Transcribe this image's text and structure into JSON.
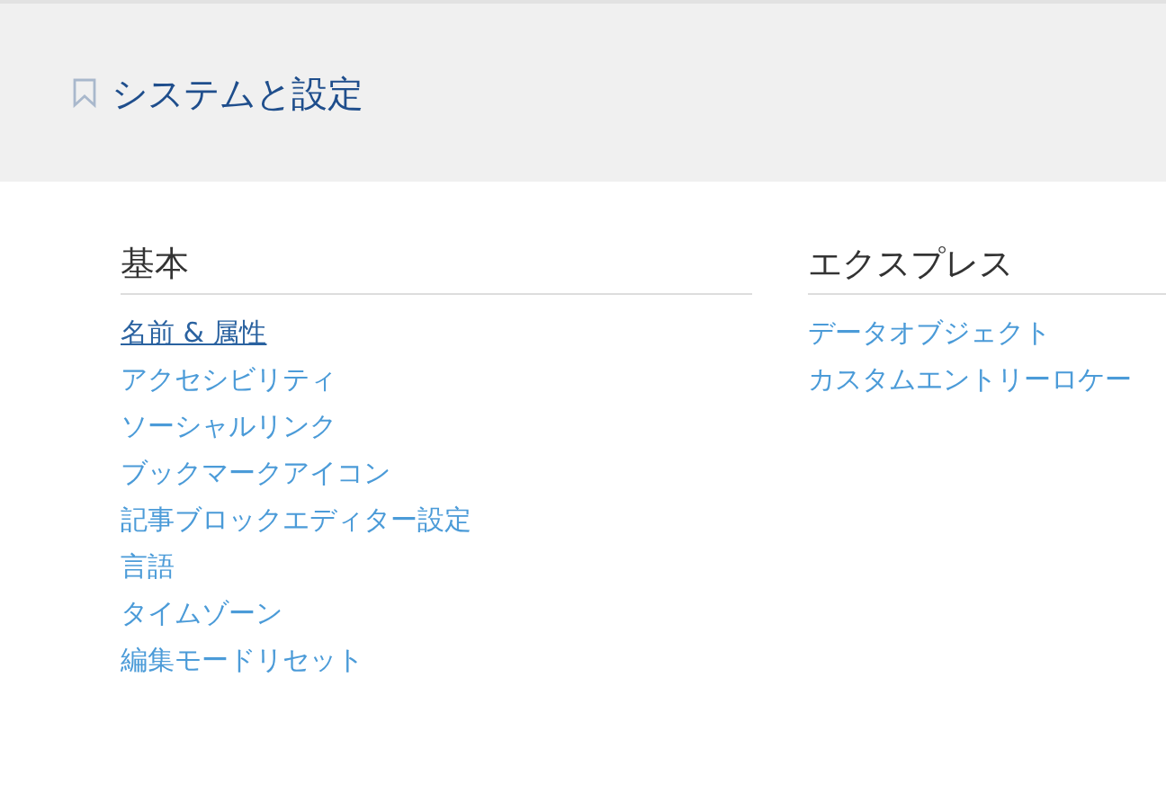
{
  "header": {
    "title": "システムと設定"
  },
  "sections": [
    {
      "heading": "基本",
      "links": [
        {
          "label": "名前 & 属性",
          "hovered": true
        },
        {
          "label": "アクセシビリティ",
          "hovered": false
        },
        {
          "label": "ソーシャルリンク",
          "hovered": false
        },
        {
          "label": "ブックマークアイコン",
          "hovered": false
        },
        {
          "label": "記事ブロックエディター設定",
          "hovered": false
        },
        {
          "label": "言語",
          "hovered": false
        },
        {
          "label": "タイムゾーン",
          "hovered": false
        },
        {
          "label": "編集モードリセット",
          "hovered": false
        }
      ]
    },
    {
      "heading": "エクスプレス",
      "links": [
        {
          "label": "データオブジェクト",
          "hovered": false
        },
        {
          "label": "カスタムエントリーロケー",
          "hovered": false
        }
      ]
    }
  ]
}
